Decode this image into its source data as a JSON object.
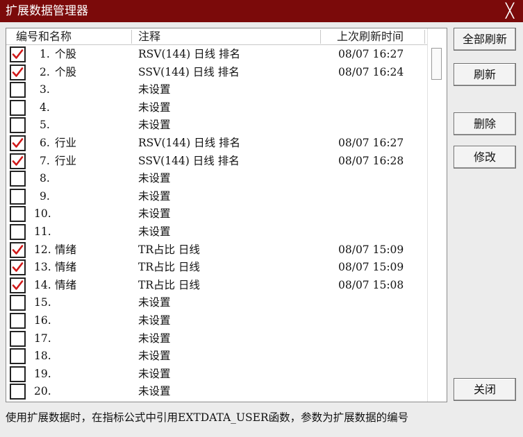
{
  "window": {
    "title": "扩展数据管理器",
    "close_glyph": "╳"
  },
  "columns": [
    "编号和名称",
    "注释",
    "上次刷新时间"
  ],
  "rows": [
    {
      "checked": true,
      "num": "1.",
      "name": "个股",
      "note": "RSV(144) 日线 排名",
      "time": "08/07 16:27"
    },
    {
      "checked": true,
      "num": "2.",
      "name": "个股",
      "note": "SSV(144) 日线 排名",
      "time": "08/07 16:24"
    },
    {
      "checked": false,
      "num": "3.",
      "name": "",
      "note": "未设置",
      "time": ""
    },
    {
      "checked": false,
      "num": "4.",
      "name": "",
      "note": "未设置",
      "time": ""
    },
    {
      "checked": false,
      "num": "5.",
      "name": "",
      "note": "未设置",
      "time": ""
    },
    {
      "checked": true,
      "num": "6.",
      "name": "行业",
      "note": "RSV(144) 日线 排名",
      "time": "08/07 16:27"
    },
    {
      "checked": true,
      "num": "7.",
      "name": "行业",
      "note": "SSV(144) 日线 排名",
      "time": "08/07 16:28"
    },
    {
      "checked": false,
      "num": "8.",
      "name": "",
      "note": "未设置",
      "time": ""
    },
    {
      "checked": false,
      "num": "9.",
      "name": "",
      "note": "未设置",
      "time": ""
    },
    {
      "checked": false,
      "num": "10.",
      "name": "",
      "note": "未设置",
      "time": ""
    },
    {
      "checked": false,
      "num": "11.",
      "name": "",
      "note": "未设置",
      "time": ""
    },
    {
      "checked": true,
      "num": "12.",
      "name": "情绪",
      "note": "TR占比 日线",
      "time": "08/07 15:09"
    },
    {
      "checked": true,
      "num": "13.",
      "name": "情绪",
      "note": "TR占比 日线",
      "time": "08/07 15:09"
    },
    {
      "checked": true,
      "num": "14.",
      "name": "情绪",
      "note": "TR占比 日线",
      "time": "08/07 15:08"
    },
    {
      "checked": false,
      "num": "15.",
      "name": "",
      "note": "未设置",
      "time": ""
    },
    {
      "checked": false,
      "num": "16.",
      "name": "",
      "note": "未设置",
      "time": ""
    },
    {
      "checked": false,
      "num": "17.",
      "name": "",
      "note": "未设置",
      "time": ""
    },
    {
      "checked": false,
      "num": "18.",
      "name": "",
      "note": "未设置",
      "time": ""
    },
    {
      "checked": false,
      "num": "19.",
      "name": "",
      "note": "未设置",
      "time": ""
    },
    {
      "checked": false,
      "num": "20.",
      "name": "",
      "note": "未设置",
      "time": ""
    }
  ],
  "buttons": {
    "refresh_all": "全部刷新",
    "refresh": "刷新",
    "delete": "删除",
    "edit": "修改",
    "close": "关闭"
  },
  "status_text": "使用扩展数据时，在指标公式中引用EXTDATA_USER函数，参数为扩展数据的编号",
  "colors": {
    "titlebar": "#7b0a0a",
    "checkmark": "#d01818"
  }
}
